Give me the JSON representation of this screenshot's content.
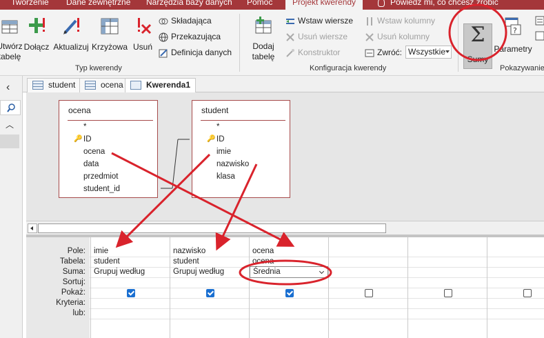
{
  "ribbon_tabs": [
    "Tworzenie",
    "Dane zewnętrzne",
    "Narzędzia bazy danych",
    "Pomoc",
    "Projekt kwerendy"
  ],
  "tell_me": "Powiedz mi, co chcesz zrobić",
  "ribbon": {
    "typ": {
      "utworz_tabele": "Utwórz tabelę",
      "dolacz": "Dołącz",
      "aktualizuj": "Aktualizuj",
      "krzyzowa": "Krzyżowa",
      "usun": "Usuń",
      "skladajaca": "Składająca",
      "przekazujaca": "Przekazująca",
      "definicja": "Definicja danych",
      "label": "Typ kwerendy"
    },
    "konfig": {
      "dodaj_tabele": "Dodaj tabelę",
      "wstaw_wiersze": "Wstaw wiersze",
      "usun_wiersze": "Usuń wiersze",
      "konstruktor": "Konstruktor",
      "wstaw_kolumny": "Wstaw kolumny",
      "usun_kolumny": "Usuń kolumny",
      "zwroc_label": "Zwróć:",
      "zwroc_value": "Wszystkie",
      "label": "Konfiguracja kwerendy"
    },
    "pokaz": {
      "sumy": "Sumy",
      "parametry": "Parametry",
      "label": "Pokazywanie"
    }
  },
  "doc_tabs": [
    "student",
    "ocena",
    "Kwerenda1"
  ],
  "tables": [
    {
      "name": "ocena",
      "fields": [
        "*",
        "ID",
        "ocena",
        "data",
        "przedmiot",
        "student_id"
      ]
    },
    {
      "name": "student",
      "fields": [
        "*",
        "ID",
        "imie",
        "nazwisko",
        "klasa"
      ]
    }
  ],
  "grid": {
    "row_labels": [
      "Pole:",
      "Tabela:",
      "Suma:",
      "Sortuj:",
      "Pokaż:",
      "Kryteria:",
      "lub:"
    ],
    "columns": [
      {
        "pole": "imie",
        "tabela": "student",
        "suma": "Grupuj według",
        "show": true
      },
      {
        "pole": "nazwisko",
        "tabela": "student",
        "suma": "Grupuj według",
        "show": true
      },
      {
        "pole": "ocena",
        "tabela": "ocena",
        "suma": "Średnia",
        "show": true
      },
      {
        "pole": "",
        "tabela": "",
        "suma": "",
        "show": false
      },
      {
        "pole": "",
        "tabela": "",
        "suma": "",
        "show": false
      },
      {
        "pole": "",
        "tabela": "",
        "suma": "",
        "show": false
      }
    ]
  },
  "colors": {
    "accent": "#a4373a",
    "annotation": "#d9232c",
    "checkbox": "#1a6fd1"
  }
}
